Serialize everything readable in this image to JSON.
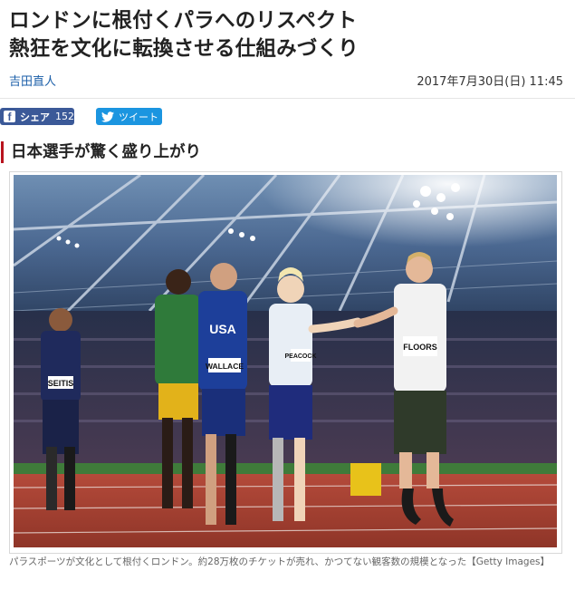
{
  "article": {
    "headline_line1": "ロンドンに根付くパラへのリスペクト",
    "headline_line2": "熱狂を文化に転換させる仕組みづくり",
    "author": "吉田直人",
    "date": "2017年7月30日(日) 11:45"
  },
  "share": {
    "facebook_label": "シェア",
    "facebook_count": "152",
    "twitter_label": "ツイート"
  },
  "section": {
    "title": "日本選手が驚く盛り上がり"
  },
  "figure": {
    "bibs": [
      "SEITIS",
      "USA",
      "WALLACE",
      "PEACOCK",
      "FLOORS"
    ],
    "caption": "パラスポーツが文化として根付くロンドン。約28万枚のチケットが売れ、かつてない観客数の規模となった【Getty Images】"
  },
  "colors": {
    "accent_red": "#b8141e",
    "facebook_blue": "#3b5998",
    "twitter_blue": "#1b95e0",
    "link_blue": "#1a5ea8"
  }
}
